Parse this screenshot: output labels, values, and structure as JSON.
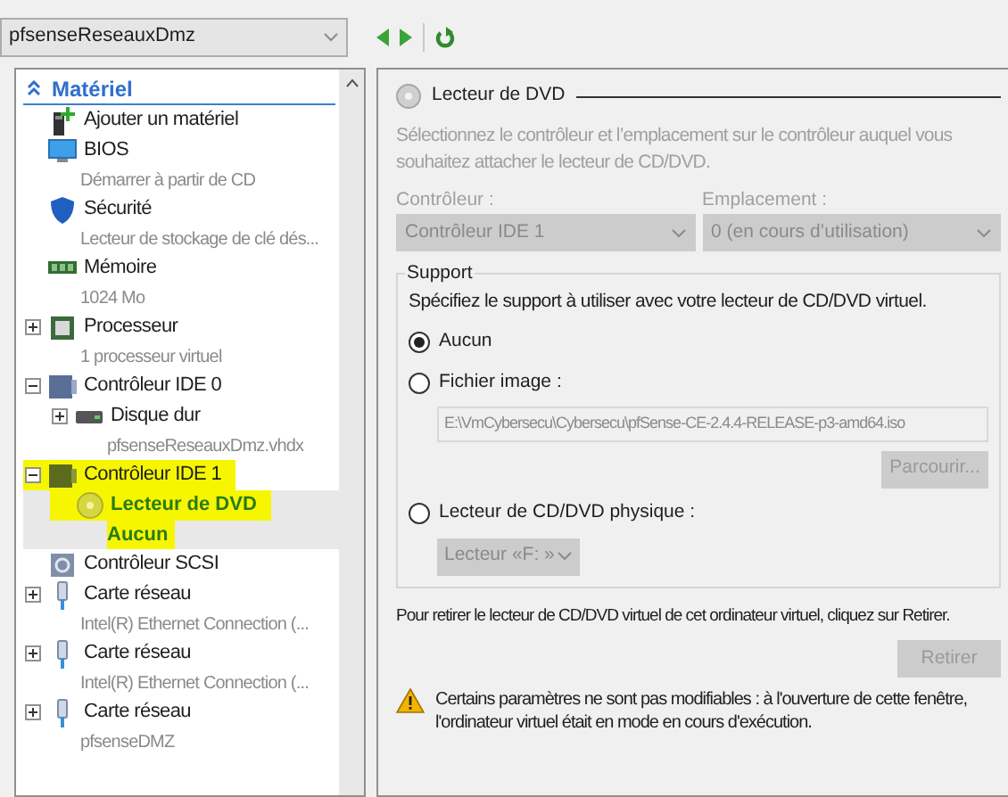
{
  "vm_selector": {
    "value": "pfsenseReseauxDmz"
  },
  "toolbar": [
    {
      "kind": "back"
    },
    {
      "kind": "forward"
    },
    {
      "kind": "refresh"
    }
  ],
  "hardware_tree": {
    "heading": "Matériel",
    "items": [
      {
        "label": "Ajouter un matériel",
        "kind": "add-hardware",
        "selected": false,
        "highlighted": false
      },
      {
        "label": "BIOS",
        "detail": "Démarrer à partir de CD",
        "kind": "bios",
        "selected": false,
        "highlighted": false
      },
      {
        "label": "Sécurité",
        "detail": "Lecteur de stockage de clé dés...",
        "kind": "security",
        "selected": false,
        "highlighted": false
      },
      {
        "label": "Mémoire",
        "detail": "1024 Mo",
        "kind": "memory",
        "selected": false,
        "highlighted": false
      },
      {
        "label": "Processeur",
        "detail": "1 processeur virtuel",
        "kind": "processor",
        "expanded": false,
        "selected": false,
        "highlighted": false
      },
      {
        "label": "Contrôleur IDE 0",
        "kind": "ide",
        "expanded": true,
        "selected": false,
        "highlighted": false,
        "children": [
          {
            "label": "Disque dur",
            "detail": "pfsenseReseauxDmz.vhdx",
            "kind": "disk",
            "expanded": false,
            "selected": false,
            "highlighted": false
          }
        ]
      },
      {
        "label": "Contrôleur IDE 1",
        "kind": "ide-active",
        "expanded": true,
        "selected": false,
        "highlighted": true,
        "children": [
          {
            "label": "Lecteur de DVD",
            "detail": "Aucun",
            "kind": "dvd",
            "selected": true,
            "highlighted": true
          }
        ]
      },
      {
        "label": "Contrôleur SCSI",
        "kind": "scsi",
        "selected": false,
        "highlighted": false
      },
      {
        "label": "Carte réseau",
        "detail": "Intel(R) Ethernet Connection (...",
        "kind": "network",
        "expanded": false,
        "selected": false,
        "highlighted": false
      },
      {
        "label": "Carte réseau",
        "detail": "Intel(R) Ethernet Connection (...",
        "kind": "network",
        "expanded": false,
        "selected": false,
        "highlighted": false
      },
      {
        "label": "Carte réseau",
        "detail": "pfsenseDMZ",
        "kind": "network",
        "expanded": false,
        "selected": false,
        "highlighted": false
      }
    ]
  },
  "dvd_drive": {
    "title": "Lecteur de DVD",
    "description": "Sélectionnez le contrôleur et l’emplacement sur le contrôleur auquel vous souhaitez attacher le lecteur de CD/DVD.",
    "controller": {
      "label": "Contrôleur :",
      "value": "Contrôleur IDE 1",
      "disabled": true
    },
    "location": {
      "label": "Emplacement :",
      "value": "0 (en cours d’utilisation)",
      "disabled": true
    },
    "media": {
      "title": "Support",
      "instruction": "Spécifiez le support à utiliser avec votre lecteur de CD/DVD virtuel.",
      "options": [
        {
          "kind": "none",
          "label": "Aucun",
          "selected": true
        },
        {
          "kind": "image",
          "label": "Fichier image :",
          "path": "E:\\VmCybersecu\\Cybersecu\\pfSense-CE-2.4.4-RELEASE-p3-amd64.iso",
          "browse": "Parcourir...",
          "selected": false
        },
        {
          "kind": "physical",
          "label": "Lecteur de CD/DVD physique :",
          "drive": "Lecteur «F: »",
          "selected": false
        }
      ]
    },
    "remove_hint": "Pour retirer le lecteur de CD/DVD virtuel de cet ordinateur virtuel, cliquez sur Retirer.",
    "remove_button": "Retirer",
    "warning": "Certains paramètres ne sont pas modifiables : à l'ouverture de cette fenêtre, l'ordinateur virtuel était en mode en cours d'exécution."
  }
}
